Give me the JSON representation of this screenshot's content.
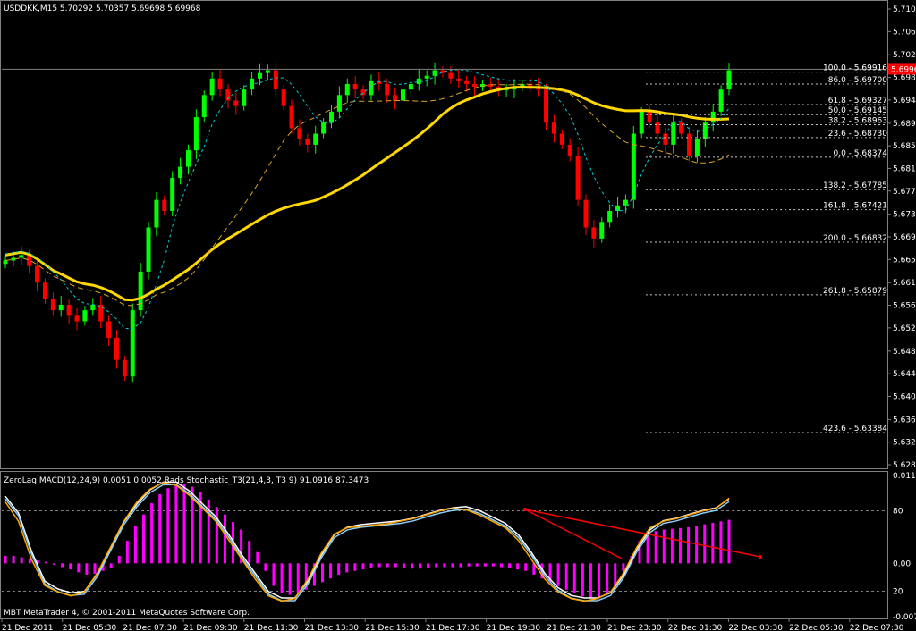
{
  "window": {
    "main_title": "USDDKK,M15  5.70292 5.70357 5.69698 5.69968",
    "sub_title": "ZeroLag MACD(12,24,9) 0.0051 0.0052  Rads Stochastic_T3(21,4,3, T3 9) 91.0916 87.3473",
    "copyright": "MBT MetaTrader 4, © 2001-2011 MetaQuotes Software Corp."
  },
  "colors": {
    "bull_candle": "#00ff00",
    "bear_candle": "#ff0000",
    "ma_long": "#ffd700",
    "ma_dashed": "#daa520",
    "band": "#00ced1",
    "macd_hist": "#ff00ff",
    "stoch_main": "#ffa500",
    "stoch_signal": "#87cefa",
    "stoch_white": "#ffffff",
    "divergence": "#ff0000",
    "current_price_bg": "#ff0000"
  },
  "current_price": "5.69968",
  "chart_data": [
    {
      "type": "candlestick",
      "symbol": "USDDKK",
      "timeframe": "M15",
      "y_ticks": [
        "5.71060",
        "5.70650",
        "5.70230",
        "5.69820",
        "5.69410",
        "5.68990",
        "5.68580",
        "5.68170",
        "5.67760",
        "5.67340",
        "5.66930",
        "5.66520",
        "5.66100",
        "5.65690",
        "5.65280",
        "5.64860",
        "5.64450",
        "5.64040",
        "5.63620",
        "5.63210",
        "5.62800"
      ],
      "x_ticks": [
        "21 Dec 2011",
        "21 Dec 05:30",
        "21 Dec 07:30",
        "21 Dec 09:30",
        "21 Dec 11:30",
        "21 Dec 13:30",
        "21 Dec 15:30",
        "21 Dec 17:30",
        "21 Dec 19:30",
        "21 Dec 21:30",
        "21 Dec 23:30",
        "22 Dec 01:30",
        "22 Dec 03:30",
        "22 Dec 05:30",
        "22 Dec 07:30"
      ],
      "ylim": [
        5.628,
        5.7106
      ],
      "closes": [
        5.665,
        5.6655,
        5.666,
        5.664,
        5.661,
        5.658,
        5.656,
        5.657,
        5.655,
        5.654,
        5.656,
        5.657,
        5.654,
        5.651,
        5.647,
        5.644,
        5.656,
        5.663,
        5.671,
        5.676,
        5.674,
        5.68,
        5.682,
        5.685,
        5.691,
        5.695,
        5.698,
        5.696,
        5.694,
        5.693,
        5.696,
        5.698,
        5.699,
        5.6995,
        5.696,
        5.693,
        5.689,
        5.687,
        5.686,
        5.688,
        5.69,
        5.692,
        5.695,
        5.697,
        5.696,
        5.695,
        5.6975,
        5.697,
        5.695,
        5.694,
        5.696,
        5.697,
        5.698,
        5.6985,
        5.6995,
        5.699,
        5.698,
        5.6975,
        5.697,
        5.6965,
        5.697,
        5.6965,
        5.696,
        5.696,
        5.6965,
        5.697,
        5.6965,
        5.696,
        5.69,
        5.688,
        5.686,
        5.684,
        5.676,
        5.671,
        5.669,
        5.672,
        5.674,
        5.675,
        5.676,
        5.688,
        5.692,
        5.69,
        5.688,
        5.686,
        5.69,
        5.688,
        5.684,
        5.687,
        5.69,
        5.692,
        5.696,
        5.6995
      ],
      "fibonacci_levels": [
        {
          "label": "100.0 - 5.69916",
          "value": 5.69916
        },
        {
          "label": "86.0 - 5.69700",
          "value": 5.697
        },
        {
          "label": "61.8 - 5.69327",
          "value": 5.69327
        },
        {
          "label": "50.0 - 5.69145",
          "value": 5.69145
        },
        {
          "label": "38.2 - 5.68963",
          "value": 5.68963
        },
        {
          "label": "23.6 - 5.68730",
          "value": 5.6873
        },
        {
          "label": "0.0 - 5.68374",
          "value": 5.68374
        },
        {
          "label": "138.2 - 5.67785",
          "value": 5.67785
        },
        {
          "label": "161.8 - 5.67421",
          "value": 5.67421
        },
        {
          "label": "200.0 - 5.66832",
          "value": 5.66832
        },
        {
          "label": "261.8 - 5.65879",
          "value": 5.65879
        },
        {
          "label": "423.6 - 5.63384",
          "value": 5.63384
        }
      ]
    },
    {
      "type": "bar",
      "name": "ZeroLag MACD / Rads Stochastic",
      "y_ticks": [
        "0.0117",
        "80",
        "0.00",
        "20",
        "-0.0071"
      ],
      "histogram": [
        0.001,
        0.001,
        0.0008,
        0.0006,
        0.0004,
        0.0002,
        -0.0002,
        -0.0005,
        -0.0008,
        -0.0012,
        -0.0015,
        -0.0014,
        -0.001,
        -0.0006,
        0.001,
        0.003,
        0.005,
        0.0065,
        0.008,
        0.0092,
        0.01,
        0.0104,
        0.0106,
        0.0102,
        0.0095,
        0.0085,
        0.0075,
        0.0065,
        0.0055,
        0.0045,
        0.003,
        0.0015,
        -0.001,
        -0.003,
        -0.004,
        -0.0042,
        -0.004,
        -0.0035,
        -0.003,
        -0.0025,
        -0.002,
        -0.0015,
        -0.0012,
        -0.001,
        -0.0008,
        -0.0006,
        -0.0005,
        -0.0005,
        -0.0005,
        -0.0006,
        -0.0007,
        -0.0007,
        -0.0006,
        -0.0005,
        -0.0005,
        -0.0005,
        -0.0005,
        -0.0004,
        -0.0004,
        -0.0004,
        -0.0004,
        -0.0005,
        -0.0006,
        -0.0008,
        -0.001,
        -0.0015,
        -0.002,
        -0.0025,
        -0.003,
        -0.0035,
        -0.004,
        -0.0044,
        -0.0046,
        -0.0045,
        -0.004,
        -0.003,
        -0.001,
        0.001,
        0.003,
        0.004,
        0.0043,
        0.0045,
        0.0046,
        0.0047,
        0.0048,
        0.005,
        0.0052,
        0.0054,
        0.0056,
        0.0058
      ],
      "stoch_main": [
        85,
        70,
        40,
        20,
        15,
        12,
        15,
        30,
        50,
        70,
        85,
        95,
        100,
        98,
        90,
        80,
        70,
        55,
        40,
        25,
        12,
        8,
        10,
        25,
        45,
        60,
        65,
        66,
        67,
        68,
        70,
        72,
        75,
        78,
        80,
        79,
        75,
        70,
        65,
        55,
        40,
        25,
        15,
        10,
        8,
        10,
        15,
        30,
        50,
        65,
        70,
        72,
        75,
        78,
        80,
        88
      ],
      "stoch_signal": [
        88,
        75,
        45,
        22,
        16,
        13,
        14,
        28,
        48,
        68,
        82,
        93,
        99,
        99,
        92,
        82,
        72,
        58,
        42,
        28,
        14,
        9,
        9,
        22,
        42,
        58,
        64,
        66,
        67,
        68,
        69,
        71,
        74,
        77,
        79,
        80,
        77,
        72,
        67,
        58,
        44,
        28,
        17,
        11,
        9,
        9,
        13,
        27,
        47,
        62,
        69,
        71,
        74,
        77,
        79,
        86
      ]
    }
  ]
}
